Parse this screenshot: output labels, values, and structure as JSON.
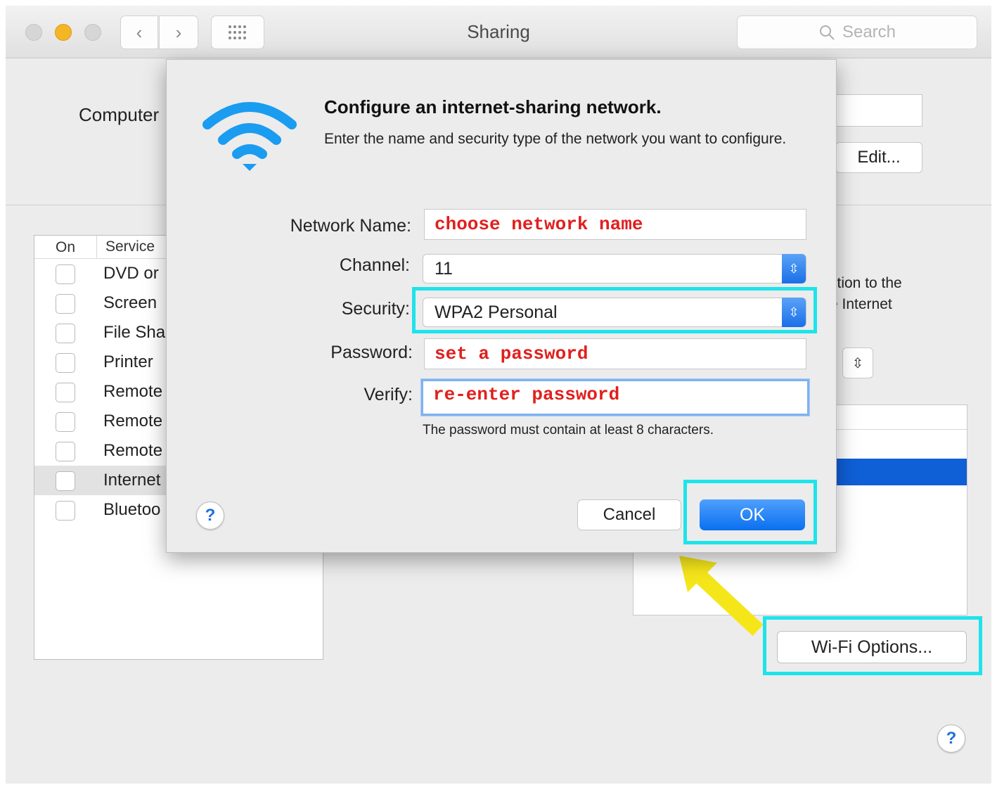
{
  "window": {
    "title": "Sharing",
    "search_placeholder": "Search"
  },
  "toolbar": {
    "back_glyph": "‹",
    "forward_glyph": "›"
  },
  "computer": {
    "label_visible": "Computer",
    "edit_label": "Edit..."
  },
  "services": {
    "header_on": "On",
    "header_service": "Service",
    "items": [
      {
        "label": "DVD or",
        "checked": false,
        "selected": false
      },
      {
        "label": "Screen",
        "checked": false,
        "selected": false
      },
      {
        "label": "File Sha",
        "checked": false,
        "selected": false
      },
      {
        "label": "Printer",
        "checked": false,
        "selected": false
      },
      {
        "label": "Remote",
        "checked": false,
        "selected": false
      },
      {
        "label": "Remote",
        "checked": false,
        "selected": false
      },
      {
        "label": "Remote",
        "checked": false,
        "selected": false
      },
      {
        "label": "Internet",
        "checked": false,
        "selected": true
      },
      {
        "label": "Bluetoo",
        "checked": false,
        "selected": false
      }
    ]
  },
  "right_panel": {
    "text_line1": "ction to the",
    "text_line2": "e Internet",
    "wifi_options_label": "Wi-Fi Options..."
  },
  "sheet": {
    "title": "Configure an internet-sharing network.",
    "description": "Enter the name and security type of the network you want to configure.",
    "labels": {
      "network_name": "Network Name:",
      "channel": "Channel:",
      "security": "Security:",
      "password": "Password:",
      "verify": "Verify:"
    },
    "values": {
      "network_name": "choose network name",
      "channel": "11",
      "security": "WPA2 Personal",
      "password": "set a password",
      "verify": "re-enter password"
    },
    "hint": "The password must contain at least 8 characters.",
    "cancel_label": "Cancel",
    "ok_label": "OK",
    "help_glyph": "?"
  },
  "help_glyph": "?",
  "colors": {
    "accent": "#0a6ff0",
    "highlight": "#1fe3ea",
    "annotation_text": "#e0201e",
    "arrow": "#f5e61a"
  }
}
